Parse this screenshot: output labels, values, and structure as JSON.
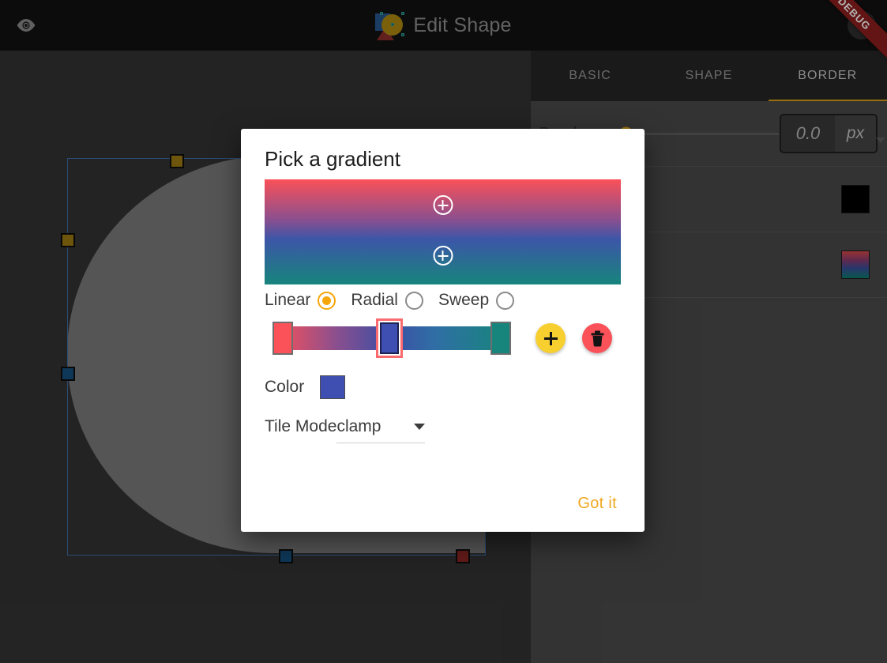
{
  "appbar": {
    "title": "Edit Shape",
    "visibility_icon": "eye-icon",
    "logo_icon": "shape-logo-icon",
    "debug_ribbon": "DEBUG"
  },
  "canvas": {
    "shape_fill": "#7a7a7a",
    "selection_color": "#3e6ea8",
    "handles": [
      {
        "name": "corner-radius-handle-top",
        "color": "#9c7a10"
      },
      {
        "name": "corner-radius-handle-left",
        "color": "#9c7a10"
      },
      {
        "name": "size-handle-left",
        "color": "#15507f"
      },
      {
        "name": "size-handle-bottom",
        "color": "#15507f"
      },
      {
        "name": "rotate-handle",
        "color": "#8c2623"
      }
    ]
  },
  "panel": {
    "tabs": [
      {
        "label": "BASIC",
        "active": false
      },
      {
        "label": "SHAPE",
        "active": false
      },
      {
        "label": "BORDER",
        "active": true
      }
    ],
    "active_tab_accent": "#d8a016",
    "rows": [
      {
        "label": "Border",
        "slider_value": 0,
        "value": "0.0",
        "unit": "px"
      },
      {
        "label": "",
        "swatch": "#000000",
        "swatch_kind": "solid"
      },
      {
        "label": "",
        "swatch": "gradient",
        "swatch_kind": "gradient"
      }
    ]
  },
  "dialog": {
    "title": "Pick a gradient",
    "preview": {
      "stops": [
        "#fb5158",
        "#8b4f8e",
        "#3c56a8",
        "#17857c"
      ],
      "add_top_label": "+",
      "add_bottom_label": "+"
    },
    "gradient_types": [
      {
        "label": "Linear",
        "selected": true
      },
      {
        "label": "Radial",
        "selected": false
      },
      {
        "label": "Sweep",
        "selected": false
      }
    ],
    "stops_bar": {
      "stops": [
        {
          "color": "#fb5158",
          "position": 0,
          "selected": false
        },
        {
          "color": "#3f4eb1",
          "position": 50,
          "selected": true
        },
        {
          "color": "#17857c",
          "position": 100,
          "selected": false
        }
      ],
      "add_button": "add-stop-icon",
      "delete_button": "delete-stop-icon"
    },
    "color": {
      "label": "Color",
      "value": "#3f4eb1"
    },
    "tile_mode": {
      "label": "Tile Mode",
      "value": "clamp"
    },
    "confirm_label": "Got it"
  }
}
